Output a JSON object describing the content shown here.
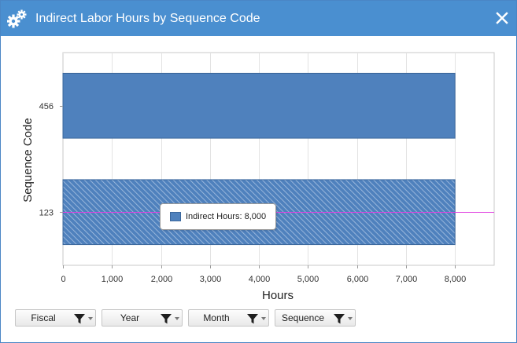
{
  "window": {
    "title": "Indirect Labor Hours by Sequence Code",
    "icon": "gears-icon",
    "close_icon": "close-icon"
  },
  "chart_data": {
    "type": "bar",
    "orientation": "horizontal",
    "categories": [
      "456",
      "123"
    ],
    "series": [
      {
        "name": "Indirect Hours",
        "values": [
          8000,
          8000
        ],
        "color": "#4f81bd"
      }
    ],
    "selected_category": "123",
    "xlabel": "Hours",
    "ylabel": "Sequence Code",
    "xlim": [
      0,
      8800
    ],
    "xticks": [
      0,
      1000,
      2000,
      3000,
      4000,
      5000,
      6000,
      7000,
      8000
    ],
    "xtick_labels": [
      "0",
      "1,000",
      "2,000",
      "3,000",
      "4,000",
      "5,000",
      "6,000",
      "7,000",
      "8,000"
    ],
    "grid": "vertical",
    "crosshair_color": "#e040e0"
  },
  "tooltip": {
    "text": "Indirect Hours: 8,000",
    "color": "#4f81bd"
  },
  "filters": [
    {
      "label": "Fiscal"
    },
    {
      "label": "Year"
    },
    {
      "label": "Month"
    },
    {
      "label": "Sequence"
    }
  ]
}
